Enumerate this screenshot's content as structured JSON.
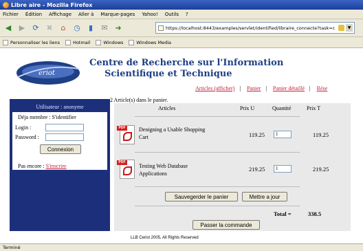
{
  "window": {
    "title": "Libre aire - Mozilla Firefox"
  },
  "menubar": [
    "Fichier",
    "Édition",
    "Affichage",
    "Aller à",
    "Marque-pages",
    "Yahoo!",
    "Outils",
    "?"
  ],
  "address": {
    "url": "https://localhost:8443/examples/servlet/identified/libraire_connecte?task=c"
  },
  "bookmarks": [
    "Personnaliser les liens",
    "Hotmail",
    "Windows",
    "Windows Media"
  ],
  "header": {
    "title_line1": "Centre de Recherche sur l'Information",
    "title_line2": "Scientifique et Technique"
  },
  "nav": {
    "articles": "Articles (afficher)",
    "panier": "Panier",
    "panier_detaille": "Panier détaillé",
    "reservations": "Rése"
  },
  "sidebar": {
    "user": "Utilisateur : anonyme",
    "member_prompt": "Déja membre : S'identifier",
    "login_label": "Login :",
    "password_label": "Password :",
    "connect_button": "Connexion",
    "not_yet": "Pas encore :",
    "signup_link": "S'inscrire"
  },
  "cart": {
    "count_text": "2 Article(s) dans le panier.",
    "columns": {
      "articles": "Articles",
      "prix_u": "Prix U",
      "quantite": "Quantité",
      "prix_t": "Prix T"
    },
    "items": [
      {
        "title": "Denigning a Usable Shopping Cart",
        "unit_price": "119.25",
        "qty": "1",
        "total": "119.25"
      },
      {
        "title": "Testing Web Database Applications",
        "unit_price": "219.25",
        "qty": "1",
        "total": "219.25"
      }
    ],
    "save_button": "Sauvegerder le panier",
    "update_button": "Mettre a jour",
    "total_label": "Total =",
    "total_value": "338.5",
    "checkout_button": "Passer la commande"
  },
  "footer": "LLB Cerist 2005, All Rights Reserved",
  "status": "Terminé"
}
